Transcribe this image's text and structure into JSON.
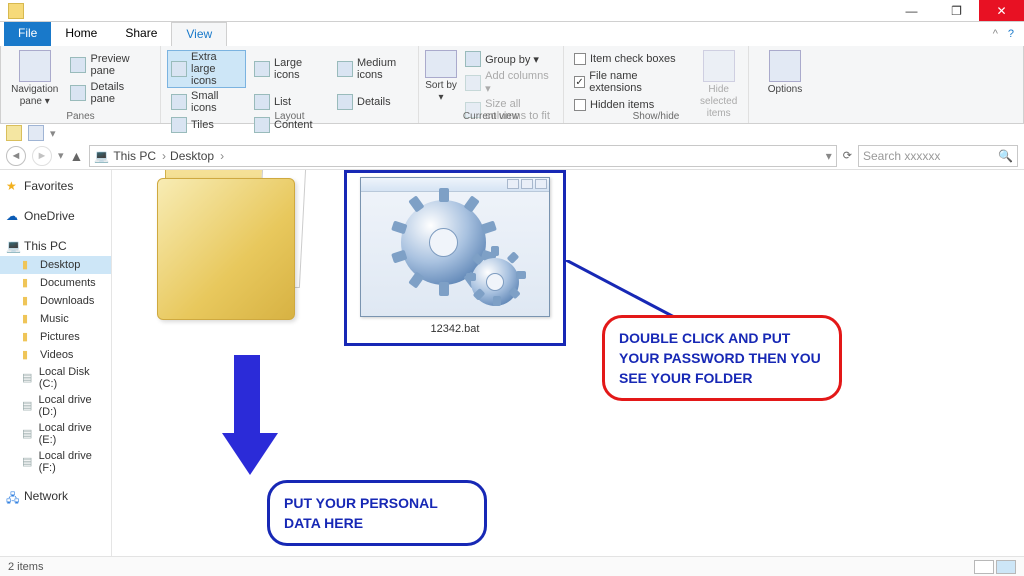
{
  "titlebar": {
    "minimize": "—",
    "maximize": "❐",
    "close": "✕"
  },
  "tabs": {
    "file": "File",
    "home": "Home",
    "share": "Share",
    "view": "View",
    "help": "?"
  },
  "ribbon": {
    "panes": {
      "nav_btn": "Navigation pane ▾",
      "preview": "Preview pane",
      "details": "Details pane",
      "label": "Panes"
    },
    "layout": {
      "xl": "Extra large icons",
      "l": "Large icons",
      "m": "Medium icons",
      "s": "Small icons",
      "list": "List",
      "details": "Details",
      "tiles": "Tiles",
      "content": "Content",
      "label": "Layout"
    },
    "current": {
      "sort": "Sort by ▾",
      "group": "Group by ▾",
      "addcols": "Add columns ▾",
      "sizecols": "Size all columns to fit",
      "label": "Current view"
    },
    "showhide": {
      "itemcheck": "Item check boxes",
      "fileext": "File name extensions",
      "hidden": "Hidden items",
      "hidesel": "Hide selected items",
      "label": "Show/hide",
      "itemcheck_checked": false,
      "fileext_checked": true,
      "hidden_checked": false
    },
    "options": {
      "btn": "Options",
      "label": ""
    }
  },
  "addr": {
    "back": "◄",
    "fwd": "►",
    "up": "▲",
    "crumbs": [
      "This PC",
      "Desktop"
    ],
    "refresh": "⟳",
    "search_placeholder": "Search xxxxxx",
    "search_icon": "🔍"
  },
  "sidebar": {
    "favorites": "Favorites",
    "onedrive": "OneDrive",
    "thispc": "This PC",
    "network": "Network",
    "pcitems": [
      "Desktop",
      "Documents",
      "Downloads",
      "Music",
      "Pictures",
      "Videos",
      "Local Disk (C:)",
      "Local drive (D:)",
      "Local drive (E:)",
      "Local drive (F:)"
    ]
  },
  "items": {
    "bat_name": "12342.bat"
  },
  "callouts": {
    "blue": "PUT YOUR PERSONAL DATA HERE",
    "red": "DOUBLE CLICK AND PUT YOUR PASSWORD THEN YOU SEE YOUR FOLDER"
  },
  "status": {
    "count": "2 items"
  }
}
